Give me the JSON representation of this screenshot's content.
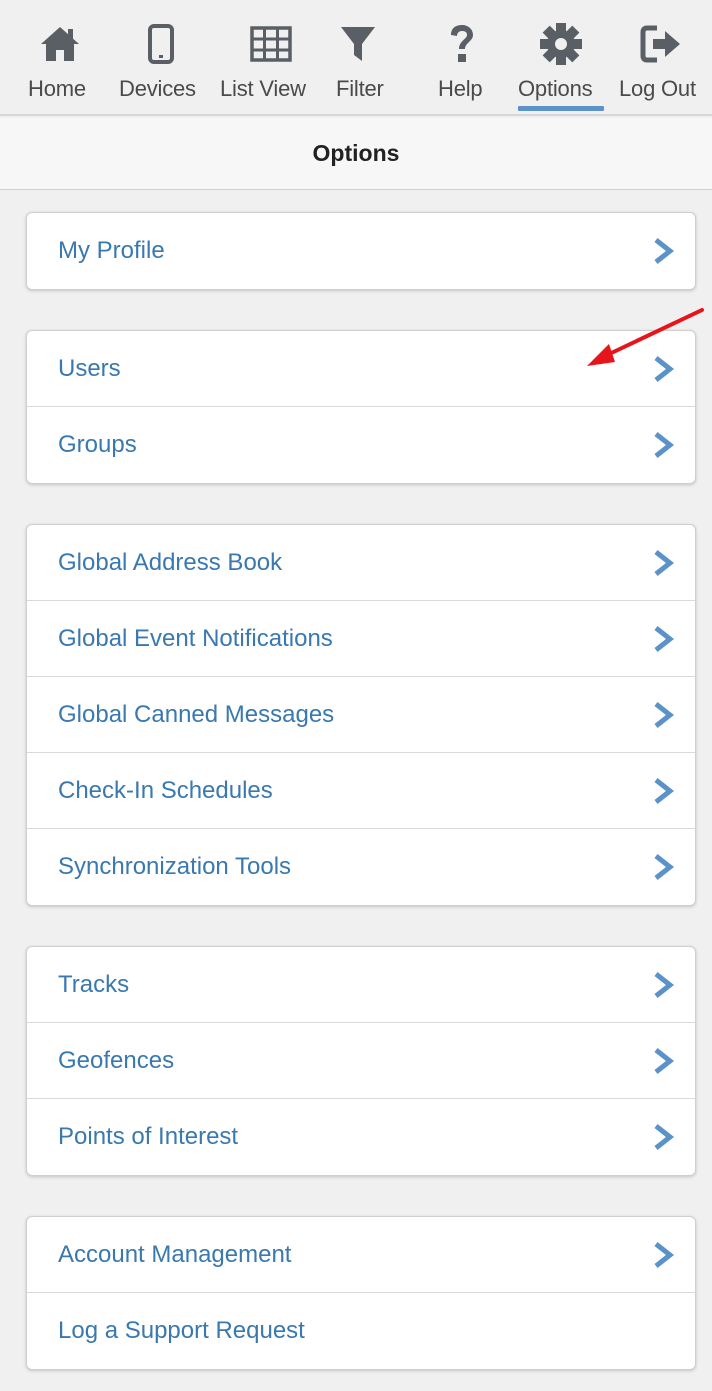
{
  "nav": {
    "items": [
      {
        "label": "Home",
        "icon": "home-icon"
      },
      {
        "label": "Devices",
        "icon": "mobile-device-icon"
      },
      {
        "label": "List View",
        "icon": "grid-table-icon"
      },
      {
        "label": "Filter",
        "icon": "filter-funnel-icon"
      },
      {
        "label": "Help",
        "icon": "question-mark-icon"
      },
      {
        "label": "Options",
        "icon": "gear-icon"
      },
      {
        "label": "Log Out",
        "icon": "sign-out-icon"
      }
    ],
    "active": "Options"
  },
  "page": {
    "title": "Options"
  },
  "groups": [
    {
      "items": [
        {
          "label": "My Profile"
        }
      ]
    },
    {
      "items": [
        {
          "label": "Users"
        },
        {
          "label": "Groups"
        }
      ]
    },
    {
      "items": [
        {
          "label": "Global Address Book"
        },
        {
          "label": "Global Event Notifications"
        },
        {
          "label": "Global Canned Messages"
        },
        {
          "label": "Check-In Schedules"
        },
        {
          "label": "Synchronization Tools"
        }
      ]
    },
    {
      "items": [
        {
          "label": "Tracks"
        },
        {
          "label": "Geofences"
        },
        {
          "label": "Points of Interest"
        }
      ]
    },
    {
      "items": [
        {
          "label": "Account Management"
        },
        {
          "label": "Log a Support Request"
        }
      ]
    }
  ],
  "colors": {
    "accent": "#5b93c8",
    "link": "#3a78b0",
    "icon": "#5a5f66",
    "annotation": "#e8141b"
  }
}
